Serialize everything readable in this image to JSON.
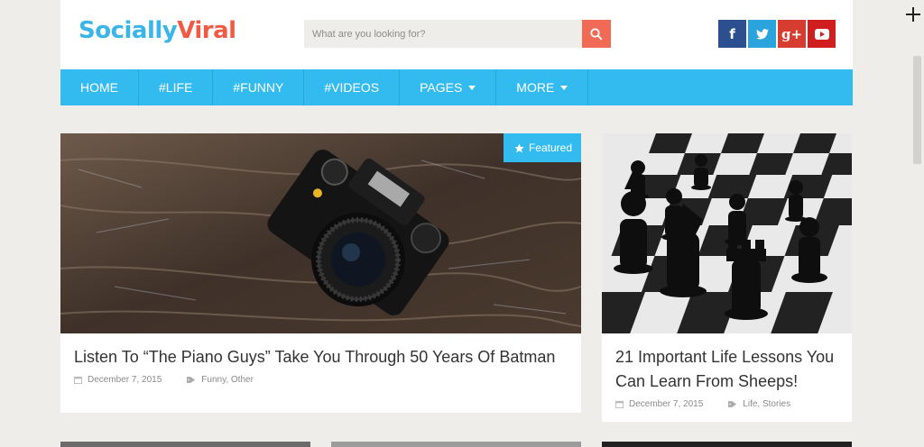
{
  "header": {
    "logo_part1": "Socially",
    "logo_part2": "Viral",
    "search_placeholder": "What are you looking for?",
    "social_icons": [
      "facebook-icon",
      "twitter-icon",
      "google-plus-icon",
      "youtube-icon"
    ],
    "social_colors": [
      "#2c4f90",
      "#2ba3dc",
      "#d63c2f",
      "#d01d1d"
    ]
  },
  "nav": {
    "items": [
      {
        "label": "HOME"
      },
      {
        "label": "#LIFE"
      },
      {
        "label": "#FUNNY"
      },
      {
        "label": "#VIDEOS"
      },
      {
        "label": "PAGES"
      },
      {
        "label": "MORE"
      }
    ]
  },
  "featured_post": {
    "badge": "Featured",
    "title": "Listen To “The Piano Guys” Take You Through 50 Years Of Batman",
    "date": "December 7, 2015",
    "categories": "Funny, Other"
  },
  "side_post": {
    "title": "21 Important Life Lessons You Can Learn From Sheeps!",
    "date": "December 7, 2015",
    "categories": "Life, Stories"
  },
  "colors": {
    "accent": "#33bbf0",
    "search_button": "#f06a55",
    "background": "#efedea"
  }
}
